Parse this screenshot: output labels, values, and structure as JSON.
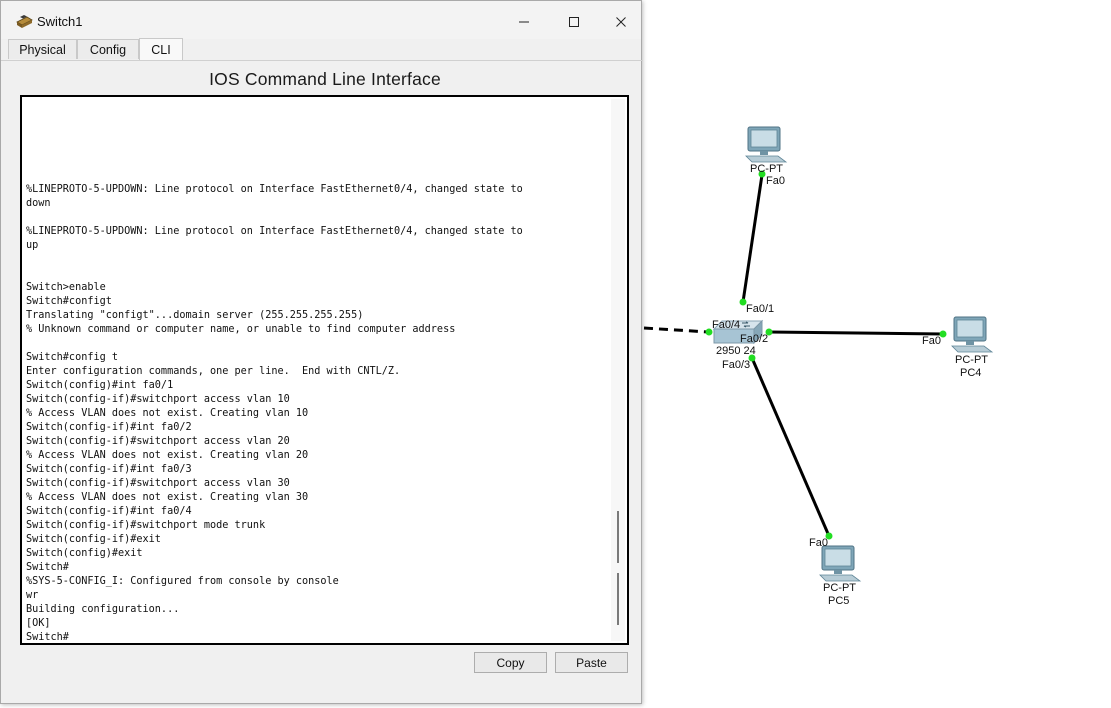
{
  "window": {
    "title": "Switch1",
    "tabs": [
      "Physical",
      "Config",
      "CLI"
    ],
    "active_tab": "CLI",
    "heading": "IOS Command Line Interface",
    "console_output": "%LINEPROTO-5-UPDOWN: Line protocol on Interface FastEthernet0/4, changed state to\ndown\n\n%LINEPROTO-5-UPDOWN: Line protocol on Interface FastEthernet0/4, changed state to\nup\n\n\nSwitch>enable\nSwitch#configt\nTranslating \"configt\"...domain server (255.255.255.255)\n% Unknown command or computer name, or unable to find computer address\n\nSwitch#config t\nEnter configuration commands, one per line.  End with CNTL/Z.\nSwitch(config)#int fa0/1\nSwitch(config-if)#switchport access vlan 10\n% Access VLAN does not exist. Creating vlan 10\nSwitch(config-if)#int fa0/2\nSwitch(config-if)#switchport access vlan 20\n% Access VLAN does not exist. Creating vlan 20\nSwitch(config-if)#int fa0/3\nSwitch(config-if)#switchport access vlan 30\n% Access VLAN does not exist. Creating vlan 30\nSwitch(config-if)#int fa0/4\nSwitch(config-if)#switchport mode trunk\nSwitch(config-if)#exit\nSwitch(config)#exit\nSwitch#\n%SYS-5-CONFIG_I: Configured from console by console\nwr\nBuilding configuration...\n[OK]\nSwitch#",
    "buttons": {
      "copy": "Copy",
      "paste": "Paste"
    }
  },
  "topology": {
    "switch": {
      "model": "2950-24",
      "model_visible": "2950 24",
      "ports": [
        "Fa0/1",
        "Fa0/2",
        "Fa0/3",
        "Fa0/4"
      ]
    },
    "pc_top": {
      "type": "PC-PT",
      "port": "Fa0"
    },
    "pc4": {
      "type": "PC-PT",
      "name": "PC4",
      "port": "Fa0"
    },
    "pc5": {
      "type": "PC-PT",
      "name": "PC5",
      "port": "Fa0"
    },
    "link_color": "#000000",
    "port_up_color": "#22dd22"
  }
}
